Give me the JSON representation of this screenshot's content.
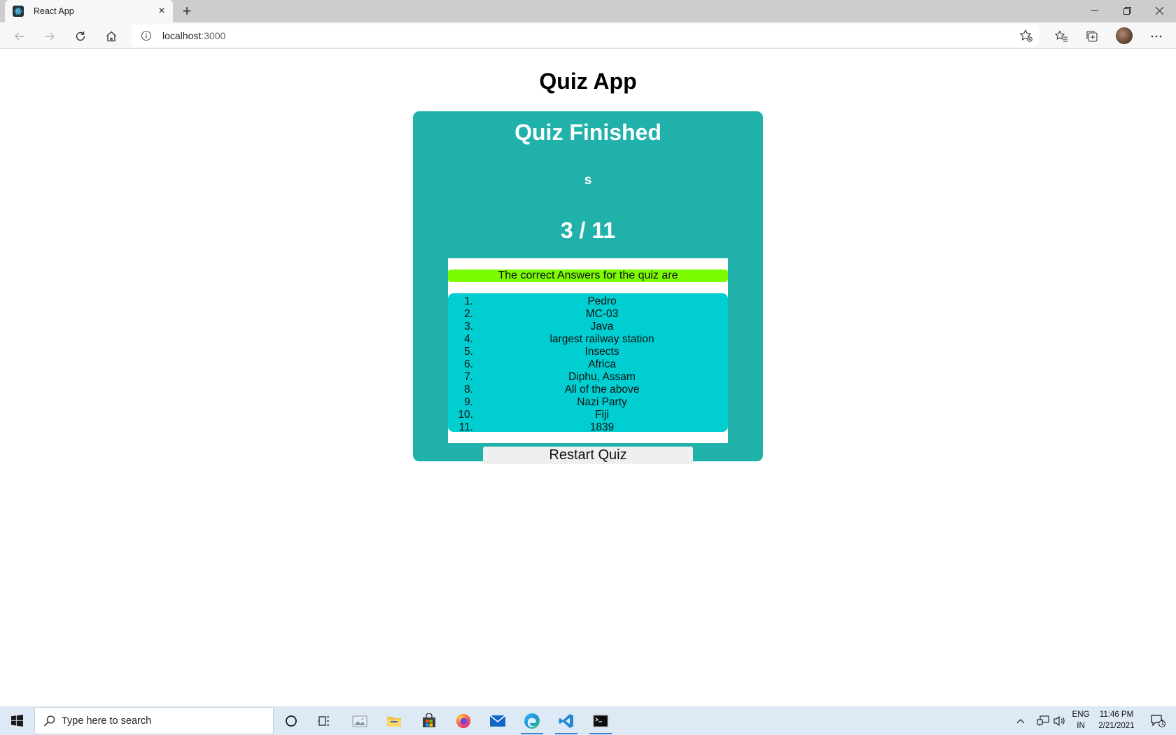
{
  "browser": {
    "tab_title": "React App",
    "url_host": "localhost",
    "url_port": ":3000"
  },
  "page": {
    "app_title": "Quiz App",
    "finished_heading": "Quiz Finished",
    "player_name": "s",
    "score": "3 / 11",
    "answers_heading": "The correct Answers for the quiz are",
    "answers": [
      {
        "num": "1.",
        "text": "Pedro"
      },
      {
        "num": "2.",
        "text": "MC-03"
      },
      {
        "num": "3.",
        "text": "Java"
      },
      {
        "num": "4.",
        "text": "largest railway station"
      },
      {
        "num": "5.",
        "text": "Insects"
      },
      {
        "num": "6.",
        "text": "Africa"
      },
      {
        "num": "7.",
        "text": "Diphu, Assam"
      },
      {
        "num": "8.",
        "text": "All of the above"
      },
      {
        "num": "9.",
        "text": "Nazi Party"
      },
      {
        "num": "10.",
        "text": "Fiji"
      },
      {
        "num": "11.",
        "text": "1839"
      }
    ],
    "restart_label": "Restart Quiz"
  },
  "colors": {
    "card_bg": "#20b2aa",
    "answers_heading_bg": "#7cfc00",
    "answers_list_bg": "#00ced1"
  },
  "taskbar": {
    "search_placeholder": "Type here to search",
    "lang_line1": "ENG",
    "lang_line2": "IN",
    "time": "11:46 PM",
    "date": "2/21/2021",
    "notification_count": "1"
  },
  "icons": {
    "tab": "react-favicon",
    "toolbar": [
      "back-icon",
      "forward-icon",
      "refresh-icon",
      "home-icon",
      "info-icon",
      "add-favorite-icon",
      "favorites-icon",
      "collections-icon",
      "more-icon"
    ],
    "taskbar": [
      "windows-start-icon",
      "search-icon",
      "cortana-icon",
      "task-view-icon",
      "photos-icon",
      "file-explorer-icon",
      "store-icon",
      "firefox-icon",
      "mail-icon",
      "edge-icon",
      "vscode-icon",
      "terminal-icon"
    ]
  }
}
